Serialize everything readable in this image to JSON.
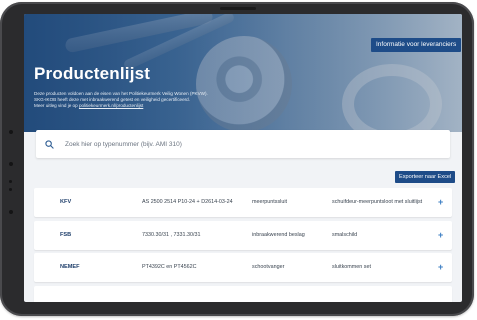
{
  "hero": {
    "title": "Productenlijst",
    "description_line1": "Deze producten voldoen aan de eisen van het Politiekeurmerk Veilig Wonen (PKVW).",
    "description_line2": "SKG-IKOB heeft deze met inbraakwerend getest en veiligheid gecertificeerd.",
    "description_line3_prefix": "Meer uitleg vind je op ",
    "description_link": "politiekeurmerk.nl/productenlijst",
    "supplier_button": "Informatie voor leveranciers"
  },
  "search": {
    "placeholder": "Zoek hier op typenummer (bijv. AMI 310)"
  },
  "export_button": "Exporteer naar Excel",
  "rows": [
    {
      "brand": "KFV",
      "type": "AS 2500 2514 P10-24 + D2614-03-24",
      "kind": "meerpuntssluit",
      "product": "schuifdeur-meerpuntsloot met sluitlijst"
    },
    {
      "brand": "FSB",
      "type": "7330.30/31 , 7331.30/31",
      "kind": "inbraakwerend beslag",
      "product": "smalschild"
    },
    {
      "brand": "NEMEF",
      "type": "PT4392C en PT4562C",
      "kind": "schootvanger",
      "product": "sluitkommen set"
    }
  ],
  "colors": {
    "primary_button": "#1e4c88",
    "plus_icon": "#3a7cc2",
    "device_frame": "#2b2b2d"
  },
  "icons": {
    "search": "search-icon",
    "expand": "plus-icon"
  }
}
